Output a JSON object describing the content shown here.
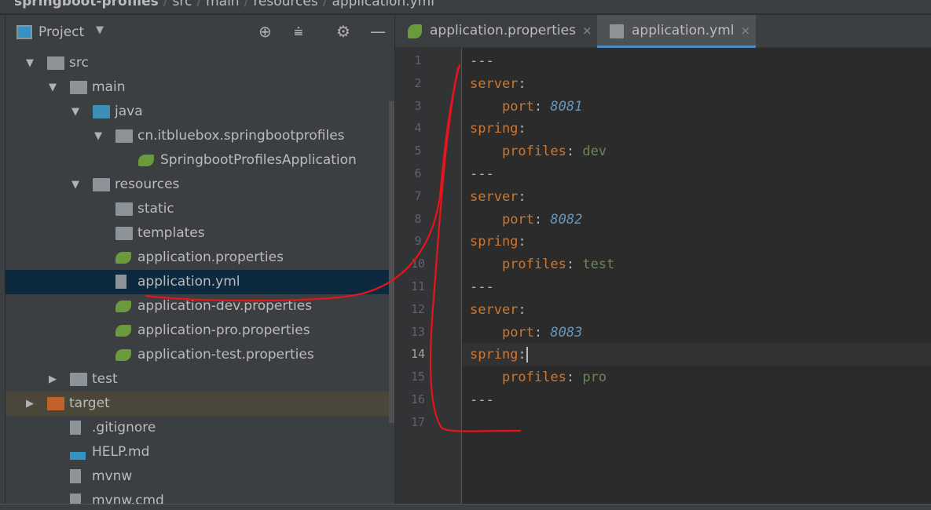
{
  "breadcrumbs": [
    "springboot-profiles",
    "src",
    "main",
    "resources",
    "application.yml"
  ],
  "project_panel": {
    "title": "Project",
    "icons": [
      "locate-icon",
      "collapse-all-icon",
      "gear-icon",
      "minimize-icon"
    ]
  },
  "tree": [
    {
      "label": "src",
      "depth": 1,
      "arrow": "▼",
      "icon": "folder"
    },
    {
      "label": "main",
      "depth": 2,
      "arrow": "▼",
      "icon": "folder"
    },
    {
      "label": "java",
      "depth": 3,
      "arrow": "▼",
      "icon": "source-folder"
    },
    {
      "label": "cn.itbluebox.springbootprofiles",
      "depth": 4,
      "arrow": "▼",
      "icon": "package"
    },
    {
      "label": "SpringbootProfilesApplication",
      "depth": 5,
      "arrow": "",
      "icon": "spring-class"
    },
    {
      "label": "resources",
      "depth": 3,
      "arrow": "▼",
      "icon": "resources-folder"
    },
    {
      "label": "static",
      "depth": 4,
      "arrow": "",
      "icon": "folder"
    },
    {
      "label": "templates",
      "depth": 4,
      "arrow": "",
      "icon": "folder"
    },
    {
      "label": "application.properties",
      "depth": 4,
      "arrow": "",
      "icon": "spring-properties"
    },
    {
      "label": "application.yml",
      "depth": 4,
      "arrow": "",
      "icon": "yaml-file",
      "selected": true
    },
    {
      "label": "application-dev.properties",
      "depth": 4,
      "arrow": "",
      "icon": "spring-properties"
    },
    {
      "label": "application-pro.properties",
      "depth": 4,
      "arrow": "",
      "icon": "spring-properties"
    },
    {
      "label": "application-test.properties",
      "depth": 4,
      "arrow": "",
      "icon": "spring-properties"
    },
    {
      "label": "test",
      "depth": 2,
      "arrow": "▶",
      "icon": "folder"
    },
    {
      "label": "target",
      "depth": 1,
      "arrow": "▶",
      "icon": "excluded-folder",
      "highlight": true
    },
    {
      "label": ".gitignore",
      "depth": 2,
      "arrow": "",
      "icon": "ignore-file"
    },
    {
      "label": "HELP.md",
      "depth": 2,
      "arrow": "",
      "icon": "markdown-file"
    },
    {
      "label": "mvnw",
      "depth": 2,
      "arrow": "",
      "icon": "shell-file"
    },
    {
      "label": "mvnw.cmd",
      "depth": 2,
      "arrow": "",
      "icon": "file"
    }
  ],
  "tabs": [
    {
      "label": "application.properties",
      "close": "×",
      "active": false
    },
    {
      "label": "application.yml",
      "close": "×",
      "active": true
    }
  ],
  "editor": {
    "current_line": 14,
    "lines": [
      [
        [
          "t",
          "---"
        ]
      ],
      [
        [
          "k",
          "server"
        ],
        [
          "t",
          ":"
        ]
      ],
      [
        [
          "t",
          "    "
        ],
        [
          "k",
          "port"
        ],
        [
          "t",
          ": "
        ],
        [
          "n",
          "8081"
        ]
      ],
      [
        [
          "k",
          "spring"
        ],
        [
          "t",
          ":"
        ]
      ],
      [
        [
          "t",
          "    "
        ],
        [
          "k",
          "profiles"
        ],
        [
          "t",
          ": "
        ],
        [
          "s",
          "dev"
        ]
      ],
      [
        [
          "t",
          "---"
        ]
      ],
      [
        [
          "k",
          "server"
        ],
        [
          "t",
          ":"
        ]
      ],
      [
        [
          "t",
          "    "
        ],
        [
          "k",
          "port"
        ],
        [
          "t",
          ": "
        ],
        [
          "n",
          "8082"
        ]
      ],
      [
        [
          "k",
          "spring"
        ],
        [
          "t",
          ":"
        ]
      ],
      [
        [
          "t",
          "    "
        ],
        [
          "k",
          "profiles"
        ],
        [
          "t",
          ": "
        ],
        [
          "s",
          "test"
        ]
      ],
      [
        [
          "t",
          "---"
        ]
      ],
      [
        [
          "k",
          "server"
        ],
        [
          "t",
          ":"
        ]
      ],
      [
        [
          "t",
          "    "
        ],
        [
          "k",
          "port"
        ],
        [
          "t",
          ": "
        ],
        [
          "n",
          "8083"
        ]
      ],
      [
        [
          "k",
          "spring"
        ],
        [
          "t",
          ":"
        ]
      ],
      [
        [
          "t",
          "    "
        ],
        [
          "k",
          "profiles"
        ],
        [
          "t",
          ": "
        ],
        [
          "s",
          "pro"
        ]
      ],
      [
        [
          "t",
          "---"
        ]
      ],
      []
    ]
  },
  "colors": {
    "annotation": "#e8141c",
    "selected": "#0d293e",
    "accent": "#4a88c7"
  }
}
